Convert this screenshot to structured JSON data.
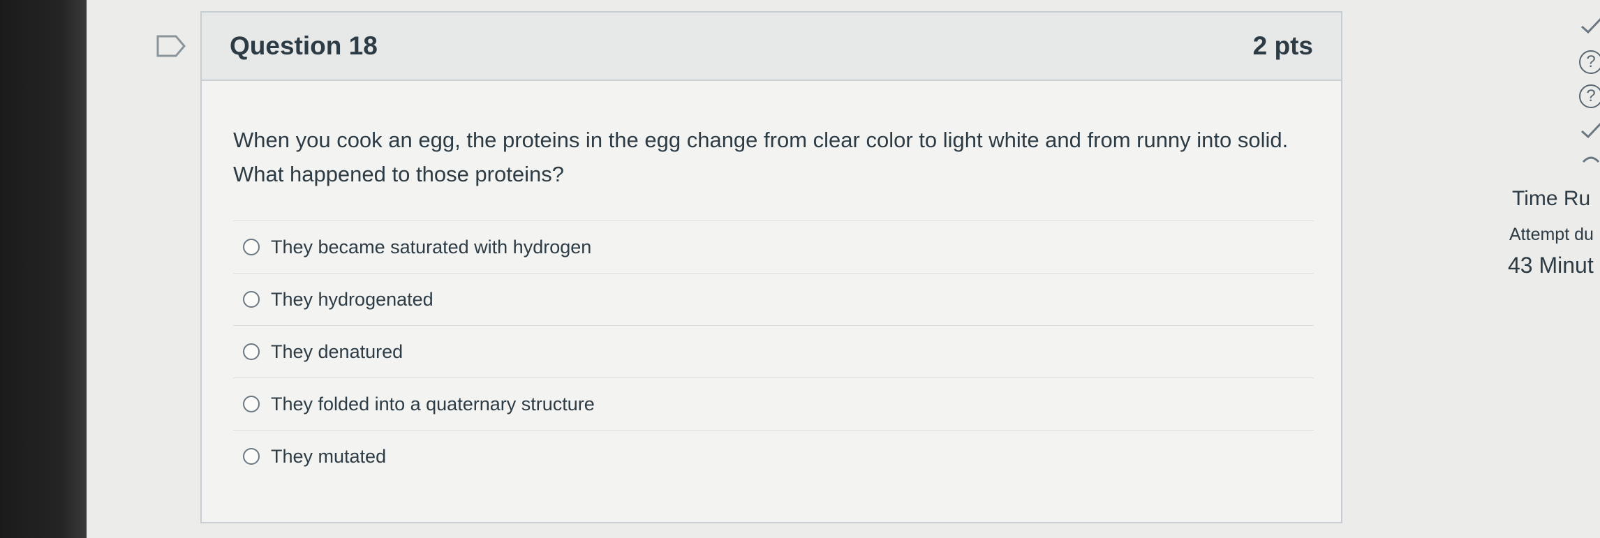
{
  "question": {
    "title": "Question 18",
    "points": "2 pts",
    "text": "When you cook an egg, the proteins in the egg change from clear color to light white and from runny into solid. What happened to those proteins?",
    "answers": [
      {
        "label": "They became saturated with hydrogen"
      },
      {
        "label": "They hydrogenated"
      },
      {
        "label": "They denatured"
      },
      {
        "label": "They folded into a quaternary structure"
      },
      {
        "label": "They mutated"
      }
    ]
  },
  "sidebar": {
    "timer_title": "Time Ru",
    "attempt_label": "Attempt du",
    "minutes": "43 Minut",
    "icons": [
      "checkmark-icon",
      "question-circle-icon",
      "question-circle-icon",
      "checkmark-icon",
      "partial-icon"
    ],
    "help_glyph": "?"
  },
  "colors": {
    "background": "#ecedeb",
    "panel": "#f3f4f2",
    "header": "#e7e9e8",
    "text": "#2d3b45",
    "border": "#c7cdd1"
  }
}
